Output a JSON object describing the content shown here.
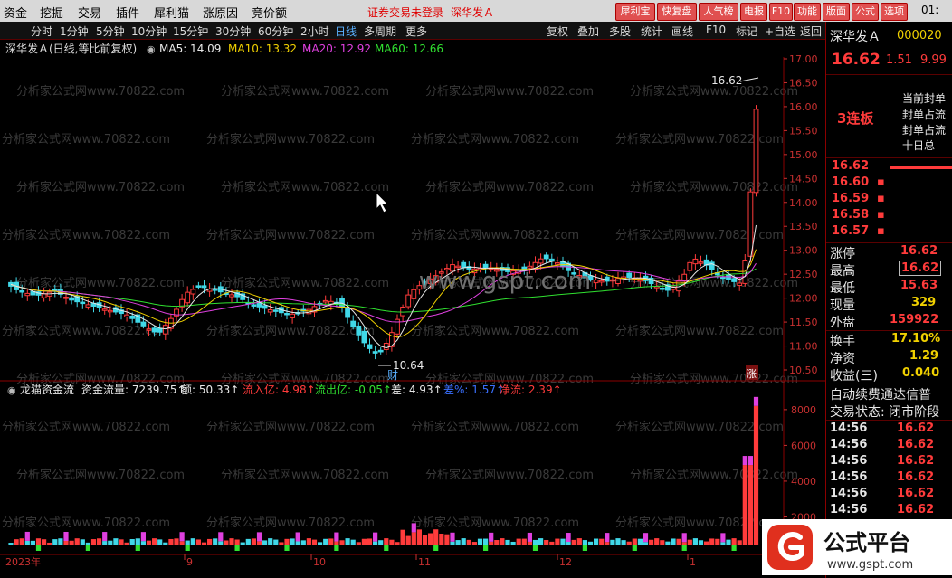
{
  "menubar": {
    "menus": [
      "资金",
      "挖掘",
      "交易",
      "插件",
      "犀利猫",
      "涨原因",
      "竞价额"
    ],
    "notice": "证券交易未登录",
    "stock_tag": "深华发Ａ",
    "tool_buttons": [
      "犀利宝",
      "快复盘",
      "人气榜",
      "电报",
      "F10",
      "功能",
      "版面",
      "公式",
      "选项"
    ],
    "clock": "01:"
  },
  "periods": {
    "items": [
      "分时",
      "1分钟",
      "5分钟",
      "10分钟",
      "15分钟",
      "30分钟",
      "60分钟",
      "2小时",
      "日线",
      "多周期",
      "更多"
    ],
    "active": "日线",
    "right_items": [
      "复权",
      "叠加",
      "多股",
      "统计",
      "画线",
      "F10",
      "标记",
      "+自选",
      "返回"
    ]
  },
  "main_chart": {
    "header": "深华发Ａ(日线,等比前复权)",
    "ma5": "MA5: 14.09",
    "ma10": "MA10: 13.32",
    "ma20": "MA20: 12.92",
    "ma60": "MA60: 12.66",
    "watermark": "分析家公式网www.70822.com",
    "center_watermark": "www.gspt.com",
    "high_label": "16.62",
    "low_label": "10.64",
    "low_marker": "财",
    "limit_marker": "涨",
    "price_ticks": [
      "17.00",
      "16.50",
      "16.00",
      "15.50",
      "15.00",
      "14.50",
      "14.00",
      "13.50",
      "13.00",
      "12.50",
      "12.00",
      "11.50",
      "11.00",
      "10.50"
    ]
  },
  "sub_chart": {
    "title": "龙猫资金流",
    "flow": "资金流量: 7239.75↑",
    "amount": "额: 50.33↑",
    "inflow": "流入亿: 4.98↑",
    "outflow": "流出亿: -0.05↑",
    "diff": "差: 4.93↑",
    "major": "差%: 1.57↑",
    "net": "净流: 2.39↑",
    "ticks": [
      "8000",
      "6000",
      "4000",
      "2000"
    ]
  },
  "time_axis": [
    "2023年",
    "9",
    "10",
    "11",
    "12",
    "1"
  ],
  "right_panel": {
    "stock_name": "深华发Ａ",
    "code": "000020",
    "price": "16.62",
    "change": "1.51",
    "pct": "9.99",
    "board": "3连板",
    "info_lines": [
      "当前封单",
      "封单占流",
      "封单占流",
      "十日总"
    ],
    "order_book": [
      {
        "price": "16.62",
        "vol": ""
      },
      {
        "price": "16.60",
        "vol": "▪"
      },
      {
        "price": "16.59",
        "vol": "▪"
      },
      {
        "price": "16.58",
        "vol": "▪"
      },
      {
        "price": "16.57",
        "vol": "▪"
      }
    ],
    "quote": [
      {
        "label": "涨停",
        "value": "16.62"
      },
      {
        "label": "最高",
        "value": "16.62"
      },
      {
        "label": "最低",
        "value": "15.63"
      },
      {
        "label": "现量",
        "value": "329"
      },
      {
        "label": "外盘",
        "value": "159922"
      },
      {
        "label": "换手",
        "value": "17.10%"
      },
      {
        "label": "净资",
        "value": "1.29"
      },
      {
        "label": "收益(三)",
        "value": "0.040"
      }
    ],
    "auto_renew": "自动续费通达信普",
    "trade_status": "交易状态: 闭市阶段",
    "ticks": [
      {
        "time": "14:56",
        "price": "16.62"
      },
      {
        "time": "14:56",
        "price": "16.62"
      },
      {
        "time": "14:56",
        "price": "16.62"
      },
      {
        "time": "14:56",
        "price": "16.62"
      },
      {
        "time": "14:56",
        "price": "16.62"
      },
      {
        "time": "14:56",
        "price": "16.62"
      }
    ]
  },
  "brand": {
    "name": "公式平台",
    "url": "www.gspt.com"
  }
}
